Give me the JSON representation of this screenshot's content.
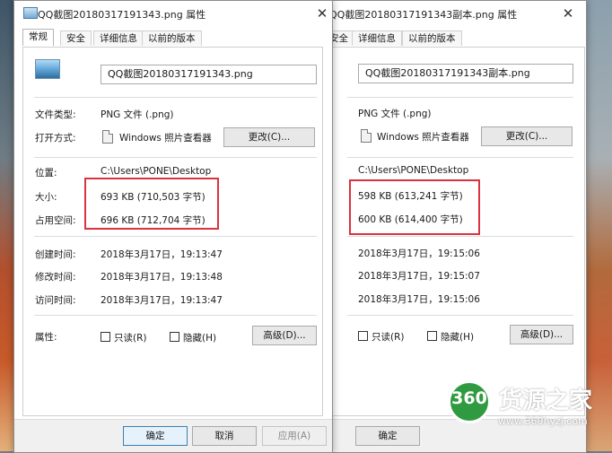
{
  "colors": {
    "highlight": "#d9333f",
    "watermark_green": "#2f9a3f"
  },
  "left": {
    "title": "QQ截图20180317191343.png 属性",
    "close": "✕",
    "tabs": [
      "常规",
      "安全",
      "详细信息",
      "以前的版本"
    ],
    "file_name": "QQ截图20180317191343.png",
    "labels": {
      "type": "文件类型:",
      "open_with": "打开方式:",
      "location": "位置:",
      "size": "大小:",
      "size_on_disk": "占用空间:",
      "created": "创建时间:",
      "modified": "修改时间:",
      "accessed": "访问时间:",
      "attributes": "属性:"
    },
    "file_type": "PNG 文件 (.png)",
    "app_name": "Windows 照片查看器",
    "change_button": "更改(C)...",
    "location": "C:\\Users\\PONE\\Desktop",
    "size": "693 KB (710,503 字节)",
    "size_on_disk": "696 KB (712,704 字节)",
    "created": "2018年3月17日，19:13:47",
    "modified": "2018年3月17日，19:13:48",
    "accessed": "2018年3月17日，19:13:47",
    "readonly": "只读(R)",
    "hidden": "隐藏(H)",
    "advanced_button": "高级(D)...",
    "ok_button": "确定",
    "cancel_button": "取消",
    "apply_button": "应用(A)"
  },
  "right": {
    "title": "QQ截图20180317191343副本.png 属性",
    "close": "✕",
    "tabs": [
      "安全",
      "详细信息",
      "以前的版本"
    ],
    "file_name": "QQ截图20180317191343副本.png",
    "file_type": "PNG 文件 (.png)",
    "app_name": "Windows 照片查看器",
    "change_button": "更改(C)...",
    "location": "C:\\Users\\PONE\\Desktop",
    "size": "598 KB (613,241 字节)",
    "size_on_disk": "600 KB (614,400 字节)",
    "created": "2018年3月17日，19:15:06",
    "modified": "2018年3月17日，19:15:07",
    "accessed": "2018年3月17日，19:15:06",
    "readonly": "只读(R)",
    "hidden": "隐藏(H)",
    "advanced_button": "高级(D)...",
    "ok_button": "确定"
  },
  "watermark": {
    "number": "360",
    "brand": "货源之家",
    "url": "www.360hyzj.com"
  }
}
